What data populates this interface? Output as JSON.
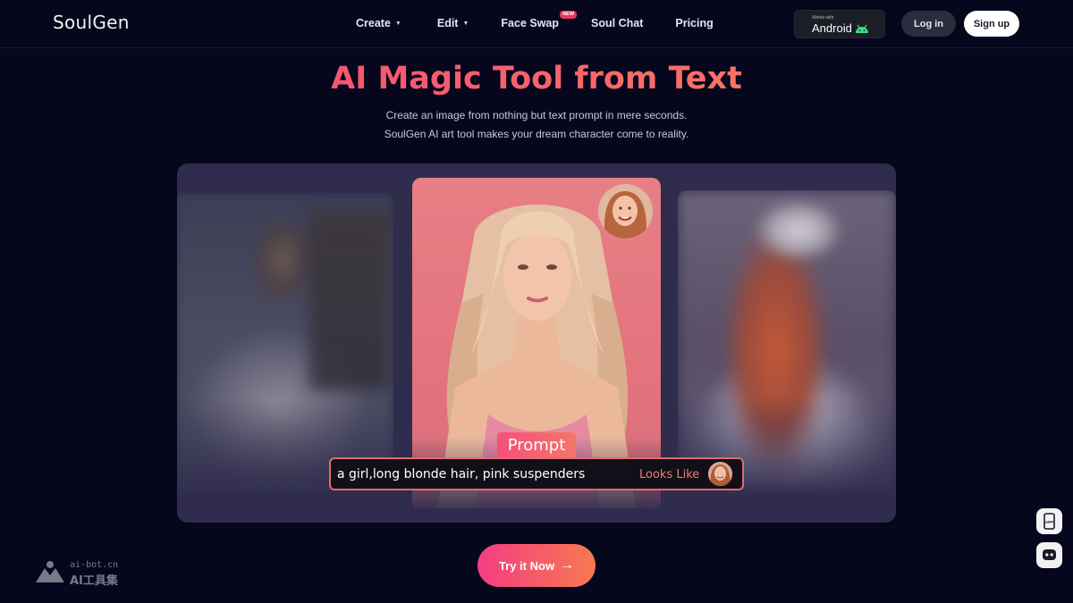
{
  "brand": {
    "logo": "SoulGen"
  },
  "nav": {
    "items": [
      {
        "label": "Create",
        "has_caret": true
      },
      {
        "label": "Edit",
        "has_caret": true
      },
      {
        "label": "Face Swap",
        "badge": "NEW"
      },
      {
        "label": "Soul Chat"
      },
      {
        "label": "Pricing"
      }
    ],
    "android": {
      "small": "Works with",
      "big": "Android",
      "icon": "android-icon"
    },
    "login": "Log in",
    "signup": "Sign up"
  },
  "hero": {
    "title": "AI Magic Tool from Text",
    "subtitle_line1": "Create an image from nothing but text prompt in mere seconds.",
    "subtitle_line2": "SoulGen AI art tool makes your dream character come to reality."
  },
  "showcase": {
    "prompt_label": "Prompt",
    "prompt_text": "a girl,long blonde hair, pink suspenders",
    "looks_like": "Looks Like"
  },
  "cta": {
    "label": "Try it Now",
    "arrow": "→"
  },
  "floating": [
    {
      "icon": "app-download-icon",
      "label": "APP"
    },
    {
      "icon": "discord-icon"
    }
  ],
  "watermark": {
    "url": "ai-bot.cn",
    "text": "AI工具集"
  },
  "colors": {
    "background": "#06061d",
    "accent_start": "#f33d84",
    "accent_end": "#f7794f",
    "showcase_bg": "#2f2c4d"
  }
}
